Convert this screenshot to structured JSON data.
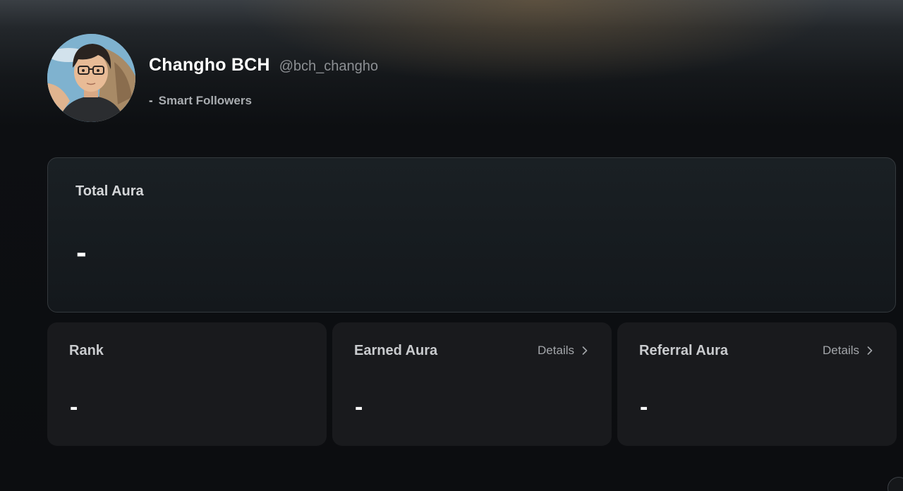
{
  "profile": {
    "display_name": "Changho BCH",
    "handle": "@bch_changho",
    "smart_followers_count": "-",
    "smart_followers_label": "Smart Followers"
  },
  "total_aura": {
    "title": "Total Aura",
    "value": "-"
  },
  "stats": [
    {
      "title": "Rank",
      "value": "-"
    },
    {
      "title": "Earned Aura",
      "value": "-",
      "details_label": "Details"
    },
    {
      "title": "Referral Aura",
      "value": "-",
      "details_label": "Details"
    }
  ],
  "icons": {
    "details_chevron": "chevron-right-icon"
  }
}
